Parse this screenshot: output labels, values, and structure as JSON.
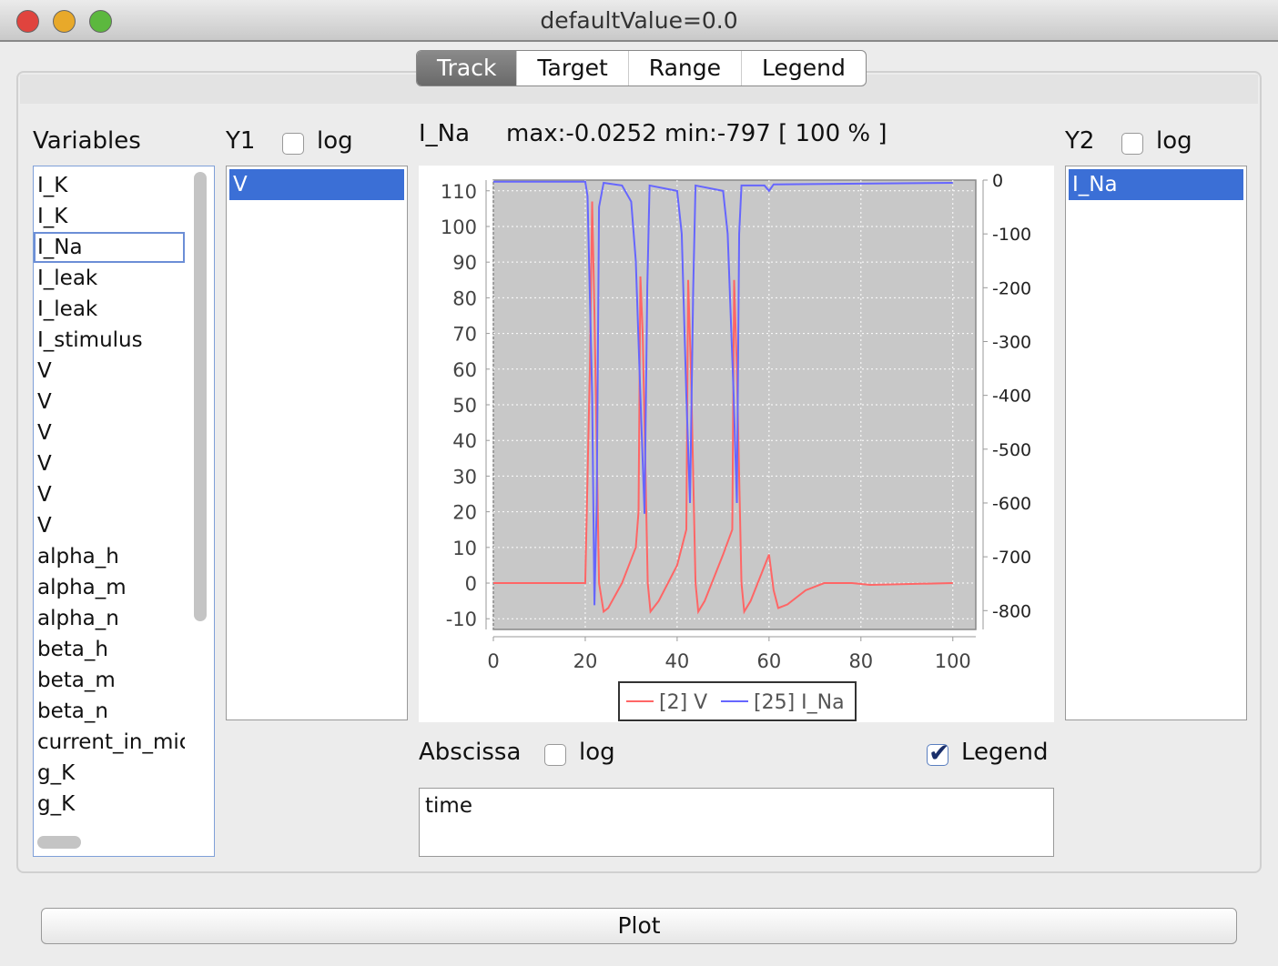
{
  "window": {
    "title": "defaultValue=0.0"
  },
  "tabs": [
    {
      "label": "Track",
      "active": true
    },
    {
      "label": "Target"
    },
    {
      "label": "Range"
    },
    {
      "label": "Legend"
    }
  ],
  "variables": {
    "label": "Variables",
    "items": [
      "I_K",
      "I_K",
      "I_Na",
      "I_leak",
      "I_leak",
      "I_stimulus",
      "V",
      "V",
      "V",
      "V",
      "V",
      "V",
      "alpha_h",
      "alpha_m",
      "alpha_n",
      "beta_h",
      "beta_m",
      "beta_n",
      "current_in_mic",
      "g_K",
      "g_K"
    ],
    "focused_index": 2
  },
  "y1": {
    "label": "Y1",
    "log_label": "log",
    "log_checked": false,
    "items": [
      "V"
    ]
  },
  "y2": {
    "label": "Y2",
    "log_label": "log",
    "log_checked": false,
    "items": [
      "I_Na"
    ]
  },
  "track_info": {
    "variable": "I_Na",
    "stats": "max:-0.0252 min:-797 [ 100 % ]"
  },
  "abscissa": {
    "label": "Abscissa",
    "log_label": "log",
    "log_checked": false,
    "value": "time"
  },
  "legend_toggle": {
    "label": "Legend",
    "checked": true
  },
  "plot_button": "Plot",
  "chart_data": {
    "type": "line",
    "xlim": [
      0,
      105
    ],
    "x_ticks": [
      0,
      20,
      40,
      60,
      80,
      100
    ],
    "y_left": {
      "lim": [
        -13,
        113
      ],
      "ticks": [
        -10,
        0,
        10,
        20,
        30,
        40,
        50,
        60,
        70,
        80,
        90,
        100,
        110
      ]
    },
    "y_right": {
      "lim": [
        -835,
        0
      ],
      "ticks": [
        0,
        -100,
        -200,
        -300,
        -400,
        -500,
        -600,
        -700,
        -800
      ]
    },
    "grid": true,
    "legend_placement": "bottom",
    "series": [
      {
        "name": "[2] V",
        "axis": "left",
        "color": "#ff6666",
        "points": [
          [
            0,
            0
          ],
          [
            20,
            0
          ],
          [
            21,
            60
          ],
          [
            21.5,
            107
          ],
          [
            22,
            76
          ],
          [
            23,
            0
          ],
          [
            24,
            -8
          ],
          [
            25,
            -7
          ],
          [
            28,
            0
          ],
          [
            31,
            10
          ],
          [
            31.6,
            20
          ],
          [
            32,
            86
          ],
          [
            32.5,
            70
          ],
          [
            33.6,
            0
          ],
          [
            34.2,
            -8
          ],
          [
            36,
            -5
          ],
          [
            40,
            5
          ],
          [
            42,
            15
          ],
          [
            42.4,
            85
          ],
          [
            43,
            60
          ],
          [
            44,
            0
          ],
          [
            44.6,
            -8
          ],
          [
            46,
            -5
          ],
          [
            50,
            8
          ],
          [
            52,
            15
          ],
          [
            52.4,
            85
          ],
          [
            53,
            60
          ],
          [
            54,
            0
          ],
          [
            54.6,
            -8
          ],
          [
            56,
            -5
          ],
          [
            60,
            8
          ],
          [
            61,
            -2
          ],
          [
            62,
            -7
          ],
          [
            64,
            -6
          ],
          [
            68,
            -2
          ],
          [
            72,
            0
          ],
          [
            78,
            0
          ],
          [
            82,
            -0.5
          ],
          [
            100,
            0
          ]
        ]
      },
      {
        "name": "[25] I_Na",
        "axis": "right",
        "color": "#6666ff",
        "points": [
          [
            0,
            -3
          ],
          [
            20,
            -3
          ],
          [
            20.5,
            -30
          ],
          [
            21.5,
            -400
          ],
          [
            22,
            -790
          ],
          [
            22.5,
            -600
          ],
          [
            23,
            -50
          ],
          [
            24,
            -5
          ],
          [
            28,
            -10
          ],
          [
            30,
            -40
          ],
          [
            31,
            -150
          ],
          [
            32,
            -400
          ],
          [
            32.9,
            -620
          ],
          [
            33.5,
            -200
          ],
          [
            34,
            -10
          ],
          [
            40,
            -20
          ],
          [
            41,
            -100
          ],
          [
            42,
            -400
          ],
          [
            42.8,
            -600
          ],
          [
            43.5,
            -200
          ],
          [
            44,
            -10
          ],
          [
            50,
            -20
          ],
          [
            51,
            -100
          ],
          [
            52.3,
            -400
          ],
          [
            53,
            -600
          ],
          [
            53.5,
            -100
          ],
          [
            54,
            -10
          ],
          [
            59,
            -10
          ],
          [
            60,
            -20
          ],
          [
            61,
            -8
          ],
          [
            100,
            -5
          ]
        ]
      }
    ]
  }
}
